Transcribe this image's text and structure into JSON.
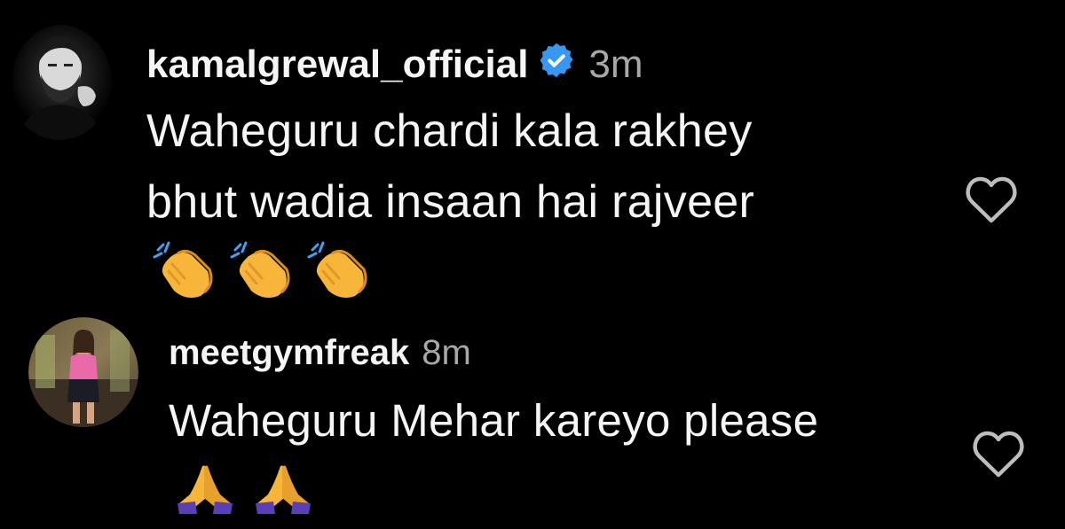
{
  "comments": [
    {
      "username": "kamalgrewal_official",
      "verified": true,
      "time": "3m",
      "lines": [
        "Waheguru chardi kala rakhey",
        "bhut wadia insaan hai rajveer"
      ],
      "emojis": [
        "clapping-hands",
        "clapping-hands",
        "clapping-hands"
      ]
    },
    {
      "username": "meetgymfreak",
      "verified": false,
      "time": "8m",
      "lines": [
        "Waheguru Mehar kareyo please"
      ],
      "emojis": [
        "folded-hands",
        "folded-hands"
      ]
    }
  ],
  "colors": {
    "background": "#000000",
    "text": "#f5f5f5",
    "muted": "#a8a8a8",
    "verified_blue": "#3897f0",
    "clap_yellow": "#f7b63a",
    "pray_purple": "#5b3fb8"
  },
  "icons": {
    "verified": "verified-badge-icon",
    "like": "heart-outline-icon",
    "clap": "clapping-hands-emoji",
    "pray": "folded-hands-emoji"
  }
}
